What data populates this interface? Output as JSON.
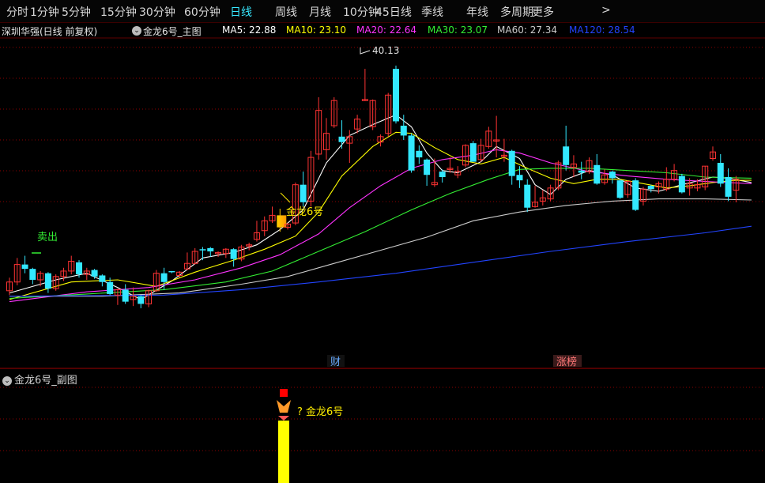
{
  "toolbar": {
    "periods": [
      "分时",
      "1分钟",
      "5分钟",
      "15分钟",
      "30分钟",
      "60分钟",
      "日线",
      "周线",
      "月线",
      "10分钟",
      "45日线",
      "季线",
      "年线",
      "多周期",
      "更多"
    ],
    "active": "日线",
    "more_arrow": ">"
  },
  "header": {
    "stock": "深圳华强(日线 前复权)",
    "indicator": "金龙6号_主图",
    "ma": [
      {
        "label": "MA5: 22.88",
        "color": "#ffffff"
      },
      {
        "label": "MA10: 23.10",
        "color": "#ffff00"
      },
      {
        "label": "MA20: 22.64",
        "color": "#ff33ff"
      },
      {
        "label": "MA30: 23.07",
        "color": "#33ee33"
      },
      {
        "label": "MA60: 27.34",
        "color": "#cccccc"
      },
      {
        "label": "MA120: 28.54",
        "color": "#2244ff"
      }
    ]
  },
  "annotations": {
    "sell": "卖出",
    "signal": "金龙6号",
    "high": "40.13",
    "cai": "财",
    "zhangbang": "涨榜"
  },
  "subchart": {
    "title": "金龙6号_副图",
    "signal_label": "? 金龙6号"
  },
  "colors": {
    "up": "#ff3333",
    "down": "#33e8ff",
    "accent": "#ffee00",
    "grid": "#8b0000"
  },
  "chart_data": {
    "type": "candlestick",
    "y_range": [
      14,
      43
    ],
    "candles": [
      [
        19.8,
        21.0,
        19.4,
        20.6
      ],
      [
        20.6,
        22.8,
        20.3,
        22.2
      ],
      [
        22.2,
        23.0,
        21.4,
        21.8
      ],
      [
        21.8,
        21.9,
        20.4,
        20.8
      ],
      [
        20.8,
        21.6,
        20.2,
        21.4
      ],
      [
        21.4,
        21.5,
        19.6,
        20.0
      ],
      [
        20.0,
        21.3,
        19.8,
        21.1
      ],
      [
        21.1,
        21.9,
        20.7,
        21.6
      ],
      [
        21.6,
        23.0,
        21.3,
        22.5
      ],
      [
        22.4,
        22.6,
        21.0,
        21.3
      ],
      [
        21.3,
        21.9,
        20.8,
        21.6
      ],
      [
        21.7,
        21.8,
        20.9,
        21.1
      ],
      [
        21.2,
        21.3,
        20.2,
        20.6
      ],
      [
        20.6,
        21.0,
        19.4,
        19.5
      ],
      [
        19.4,
        20.0,
        18.5,
        19.9
      ],
      [
        19.9,
        20.4,
        18.6,
        18.8
      ],
      [
        19.0,
        20.1,
        18.4,
        19.3
      ],
      [
        19.3,
        19.4,
        18.2,
        18.6
      ],
      [
        18.6,
        19.9,
        18.3,
        19.8
      ],
      [
        19.8,
        21.7,
        19.7,
        21.4
      ],
      [
        21.4,
        21.9,
        19.9,
        20.6
      ],
      [
        21.6,
        21.6,
        21.4,
        21.5
      ],
      [
        21.2,
        21.6,
        21.0,
        21.5
      ],
      [
        21.8,
        23.3,
        21.7,
        22.3
      ],
      [
        22.3,
        23.7,
        22.2,
        23.4
      ],
      [
        23.6,
        23.8,
        22.6,
        23.5
      ],
      [
        23.7,
        23.8,
        22.9,
        23.4
      ],
      [
        23.3,
        23.4,
        22.9,
        23.3
      ],
      [
        23.2,
        23.7,
        22.8,
        23.6
      ],
      [
        23.6,
        23.7,
        22.0,
        22.7
      ],
      [
        22.7,
        24.0,
        22.5,
        23.8
      ],
      [
        23.9,
        24.2,
        23.5,
        24.0
      ],
      [
        24.5,
        26.2,
        24.3,
        25.1
      ],
      [
        25.3,
        26.6,
        24.8,
        26.2
      ],
      [
        26.2,
        27.5,
        26.0,
        26.7
      ],
      [
        26.7,
        27.3,
        25.2,
        25.6
      ],
      [
        25.6,
        26.0,
        25.4,
        25.9
      ],
      [
        26.0,
        29.7,
        25.8,
        29.5
      ],
      [
        29.5,
        30.7,
        27.5,
        27.9
      ],
      [
        28.0,
        32.6,
        27.5,
        32.0
      ],
      [
        32.3,
        37.5,
        31.8,
        36.3
      ],
      [
        32.7,
        35.6,
        31.8,
        34.2
      ],
      [
        34.9,
        37.5,
        34.7,
        37.2
      ],
      [
        33.9,
        35.4,
        32.8,
        33.4
      ],
      [
        33.3,
        34.5,
        31.5,
        33.9
      ],
      [
        34.6,
        35.9,
        34.2,
        35.5
      ],
      [
        37.3,
        40.1,
        37.2,
        37.3
      ],
      [
        34.8,
        37.3,
        34.5,
        37.2
      ],
      [
        33.4,
        34.1,
        33.0,
        33.9
      ],
      [
        34.2,
        37.9,
        33.9,
        37.7
      ],
      [
        40.1,
        40.4,
        35.1,
        35.3
      ],
      [
        34.9,
        35.9,
        33.6,
        34.0
      ],
      [
        34.0,
        34.2,
        30.6,
        30.8
      ],
      [
        32.6,
        33.1,
        31.4,
        32.0
      ],
      [
        31.8,
        31.9,
        29.4,
        30.4
      ],
      [
        29.5,
        31.9,
        29.3,
        29.7
      ],
      [
        30.7,
        30.9,
        29.7,
        30.2
      ],
      [
        31.0,
        32.0,
        30.6,
        31.0
      ],
      [
        30.4,
        31.2,
        30.1,
        30.7
      ],
      [
        31.3,
        33.2,
        31.1,
        33.1
      ],
      [
        33.3,
        33.5,
        31.6,
        31.6
      ],
      [
        31.8,
        33.7,
        31.6,
        33.1
      ],
      [
        33.0,
        34.8,
        32.8,
        34.4
      ],
      [
        33.6,
        35.8,
        32.0,
        33.6
      ],
      [
        32.1,
        33.7,
        31.6,
        32.2
      ],
      [
        32.6,
        32.7,
        29.5,
        30.3
      ],
      [
        30.4,
        31.2,
        29.2,
        29.9
      ],
      [
        29.5,
        30.0,
        27.0,
        27.4
      ],
      [
        27.5,
        29.4,
        27.4,
        27.9
      ],
      [
        28.0,
        29.0,
        27.6,
        28.3
      ],
      [
        28.2,
        29.5,
        28.0,
        29.2
      ],
      [
        29.2,
        31.7,
        29.0,
        31.5
      ],
      [
        33.0,
        34.9,
        30.8,
        31.3
      ],
      [
        31.1,
        32.2,
        30.2,
        31.4
      ],
      [
        30.8,
        31.6,
        30.0,
        30.6
      ],
      [
        30.7,
        32.0,
        30.5,
        31.7
      ],
      [
        31.3,
        32.3,
        29.5,
        29.6
      ],
      [
        29.7,
        30.9,
        29.5,
        30.4
      ],
      [
        30.7,
        30.8,
        29.6,
        30.1
      ],
      [
        29.9,
        30.0,
        28.2,
        28.3
      ],
      [
        28.6,
        29.9,
        28.3,
        29.8
      ],
      [
        29.9,
        30.1,
        27.1,
        27.2
      ],
      [
        28.0,
        29.3,
        27.6,
        29.1
      ],
      [
        29.4,
        29.5,
        28.8,
        29.1
      ],
      [
        29.3,
        29.8,
        28.7,
        29.6
      ],
      [
        29.1,
        31.1,
        28.9,
        30.0
      ],
      [
        30.0,
        31.4,
        29.8,
        30.8
      ],
      [
        30.3,
        30.5,
        28.7,
        28.8
      ],
      [
        29.2,
        30.1,
        28.5,
        29.6
      ],
      [
        29.2,
        30.0,
        28.9,
        29.5
      ],
      [
        29.3,
        31.2,
        29.0,
        31.2
      ],
      [
        31.9,
        33.0,
        31.7,
        32.5
      ],
      [
        31.5,
        32.3,
        29.3,
        29.6
      ],
      [
        30.2,
        31.0,
        28.0,
        28.4
      ],
      [
        29.0,
        30.3,
        27.9,
        30.0
      ]
    ],
    "ma": {
      "MA5": [
        [
          0,
          19.6
        ],
        [
          6,
          20.8
        ],
        [
          10,
          21.4
        ],
        [
          14,
          20.1
        ],
        [
          17,
          19.0
        ],
        [
          21,
          20.7
        ],
        [
          25,
          22.8
        ],
        [
          29,
          23.3
        ],
        [
          32,
          24.0
        ],
        [
          35,
          25.4
        ],
        [
          38,
          27.2
        ],
        [
          41,
          31.5
        ],
        [
          44,
          34.0
        ],
        [
          47,
          35.0
        ],
        [
          50,
          35.9
        ],
        [
          52,
          34.8
        ],
        [
          54,
          32.4
        ],
        [
          56,
          30.8
        ],
        [
          58,
          30.6
        ],
        [
          61,
          31.6
        ],
        [
          63,
          33.0
        ],
        [
          66,
          31.9
        ],
        [
          68,
          29.5
        ],
        [
          70,
          28.6
        ],
        [
          72,
          30.0
        ],
        [
          75,
          30.8
        ],
        [
          78,
          30.4
        ],
        [
          81,
          29.2
        ],
        [
          84,
          28.9
        ],
        [
          87,
          29.5
        ],
        [
          91,
          30.2
        ],
        [
          93,
          30.1
        ],
        [
          96,
          29.7
        ]
      ],
      "MA10": [
        [
          0,
          19.0
        ],
        [
          8,
          20.6
        ],
        [
          14,
          20.8
        ],
        [
          19,
          20.2
        ],
        [
          24,
          21.5
        ],
        [
          29,
          22.6
        ],
        [
          33,
          23.6
        ],
        [
          37,
          24.8
        ],
        [
          40,
          27.0
        ],
        [
          43,
          30.3
        ],
        [
          47,
          33.0
        ],
        [
          50,
          34.3
        ],
        [
          52,
          34.2
        ],
        [
          55,
          32.9
        ],
        [
          58,
          31.8
        ],
        [
          61,
          31.4
        ],
        [
          64,
          32.0
        ],
        [
          67,
          31.0
        ],
        [
          70,
          30.1
        ],
        [
          73,
          29.6
        ],
        [
          76,
          30.0
        ],
        [
          79,
          30.0
        ],
        [
          82,
          29.6
        ],
        [
          85,
          29.2
        ],
        [
          88,
          29.4
        ],
        [
          91,
          29.7
        ],
        [
          94,
          29.9
        ],
        [
          96,
          29.9
        ]
      ],
      "MA20": [
        [
          0,
          18.8
        ],
        [
          10,
          19.7
        ],
        [
          18,
          20.1
        ],
        [
          24,
          20.8
        ],
        [
          30,
          21.9
        ],
        [
          35,
          23.1
        ],
        [
          40,
          25.0
        ],
        [
          44,
          27.4
        ],
        [
          48,
          29.4
        ],
        [
          52,
          31.0
        ],
        [
          56,
          31.8
        ],
        [
          60,
          32.2
        ],
        [
          63,
          32.7
        ],
        [
          66,
          32.4
        ],
        [
          70,
          31.5
        ],
        [
          75,
          30.7
        ],
        [
          80,
          30.3
        ],
        [
          85,
          30.0
        ],
        [
          90,
          29.8
        ],
        [
          96,
          29.6
        ]
      ],
      "MA30": [
        [
          0,
          19.1
        ],
        [
          10,
          19.5
        ],
        [
          20,
          19.9
        ],
        [
          28,
          20.6
        ],
        [
          34,
          21.6
        ],
        [
          40,
          23.4
        ],
        [
          46,
          25.2
        ],
        [
          52,
          27.2
        ],
        [
          57,
          28.7
        ],
        [
          62,
          30.0
        ],
        [
          66,
          30.9
        ],
        [
          70,
          31.0
        ],
        [
          75,
          31.0
        ],
        [
          80,
          30.8
        ],
        [
          85,
          30.6
        ],
        [
          90,
          30.2
        ],
        [
          96,
          30.1
        ]
      ],
      "MA60": [
        [
          0,
          19.3
        ],
        [
          12,
          19.3
        ],
        [
          22,
          19.6
        ],
        [
          30,
          20.4
        ],
        [
          36,
          21.1
        ],
        [
          42,
          22.3
        ],
        [
          48,
          23.5
        ],
        [
          54,
          24.7
        ],
        [
          60,
          26.2
        ],
        [
          66,
          27.0
        ],
        [
          72,
          27.6
        ],
        [
          78,
          28.0
        ],
        [
          84,
          28.2
        ],
        [
          90,
          28.2
        ],
        [
          96,
          28.1
        ]
      ],
      "MA120": [
        [
          0,
          19.3
        ],
        [
          20,
          19.4
        ],
        [
          30,
          19.9
        ],
        [
          40,
          20.6
        ],
        [
          50,
          21.4
        ],
        [
          60,
          22.4
        ],
        [
          70,
          23.4
        ],
        [
          80,
          24.3
        ],
        [
          90,
          25.1
        ],
        [
          96,
          25.7
        ]
      ]
    }
  }
}
